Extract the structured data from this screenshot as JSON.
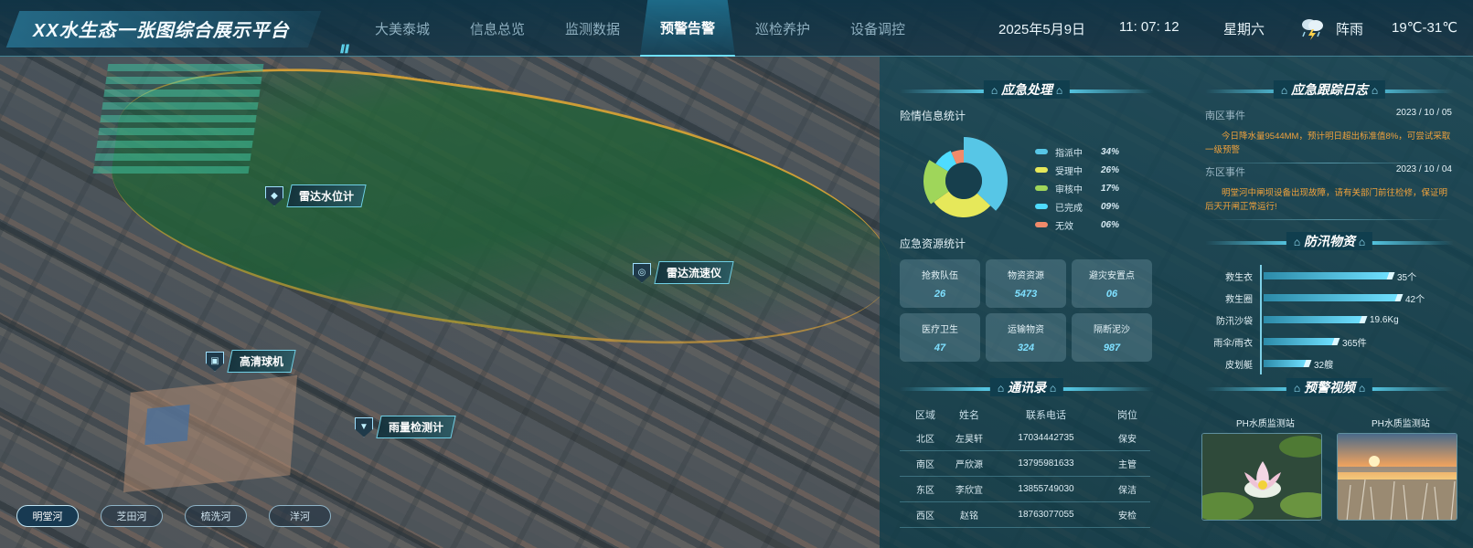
{
  "header": {
    "title": "XX水生态一张图综合展示平台",
    "nav": [
      "大美泰城",
      "信息总览",
      "监测数据",
      "预警告警",
      "巡检养护",
      "设备调控"
    ],
    "active_nav": "预警告警",
    "date": "2025年5月9日",
    "time": "11: 07: 12",
    "weekday": "星期六",
    "weather": "阵雨",
    "temperature": "19℃-31℃",
    "weather_icon": "thunder-rain-icon"
  },
  "map": {
    "markers": [
      {
        "label": "雷达水位计",
        "icon": "water-drop-icon"
      },
      {
        "label": "雷达流速仪",
        "icon": "gauge-icon"
      },
      {
        "label": "高清球机",
        "icon": "camera-icon"
      },
      {
        "label": "雨量检测计",
        "icon": "rain-gauge-icon"
      }
    ],
    "river_tabs": [
      "明堂河",
      "芝田河",
      "梳洗河",
      "洋河"
    ],
    "active_river": "明堂河"
  },
  "emergency": {
    "title": "应急处理",
    "stats_title": "险情信息统计",
    "status_stats": [
      {
        "name": "指派中",
        "percent": "34%",
        "color": "#57c6e6"
      },
      {
        "name": "受理中",
        "percent": "26%",
        "color": "#e6e85a"
      },
      {
        "name": "审核中",
        "percent": "17%",
        "color": "#9fd65a"
      },
      {
        "name": "已完成",
        "percent": "09%",
        "color": "#4fdcff"
      },
      {
        "name": "无效",
        "percent": "06%",
        "color": "#f08a6a"
      }
    ],
    "resources_title": "应急资源统计",
    "resources": [
      {
        "label": "抢救队伍",
        "value": "26"
      },
      {
        "label": "物资资源",
        "value": "5473"
      },
      {
        "label": "避灾安置点",
        "value": "06"
      },
      {
        "label": "医疗卫生",
        "value": "47"
      },
      {
        "label": "运输物资",
        "value": "324"
      },
      {
        "label": "隔断泥沙",
        "value": "987"
      }
    ]
  },
  "contacts": {
    "title": "通讯录",
    "columns": [
      "区域",
      "姓名",
      "联系电话",
      "岗位"
    ],
    "rows": [
      [
        "北区",
        "左昊轩",
        "17034442735",
        "保安"
      ],
      [
        "南区",
        "严欣源",
        "13795981633",
        "主管"
      ],
      [
        "东区",
        "李欣宜",
        "13855749030",
        "保洁"
      ],
      [
        "西区",
        "赵铭",
        "18763077055",
        "安检"
      ]
    ]
  },
  "tracking_log": {
    "title": "应急跟踪日志",
    "entries": [
      {
        "area": "南区事件",
        "date": "2023 / 10 / 05",
        "text": "今日降水量9544MM，预计明日超出标准值8%，可尝试采取一级预警"
      },
      {
        "area": "东区事件",
        "date": "2023 / 10 / 04",
        "text": "明堂河中闸坝设备出现故障，请有关部门前往检修，保证明后天开闸正常运行!"
      }
    ]
  },
  "flood_supplies": {
    "title": "防汛物资",
    "items": [
      {
        "name": "救生衣",
        "value": "35个",
        "ratio": 0.92
      },
      {
        "name": "救生圈",
        "value": "42个",
        "ratio": 0.98
      },
      {
        "name": "防汛沙袋",
        "value": "19.6Kg",
        "ratio": 0.72
      },
      {
        "name": "雨伞/雨衣",
        "value": "365件",
        "ratio": 0.52
      },
      {
        "name": "皮划艇",
        "value": "32艘",
        "ratio": 0.31
      }
    ]
  },
  "warning_video": {
    "title": "预警视频",
    "videos": [
      {
        "label": "PH水质监测站"
      },
      {
        "label": "PH水质监测站"
      }
    ]
  },
  "colors": {
    "accent": "#6fe0ff",
    "warning_text": "#f0a23c",
    "panel": "#15485a"
  }
}
